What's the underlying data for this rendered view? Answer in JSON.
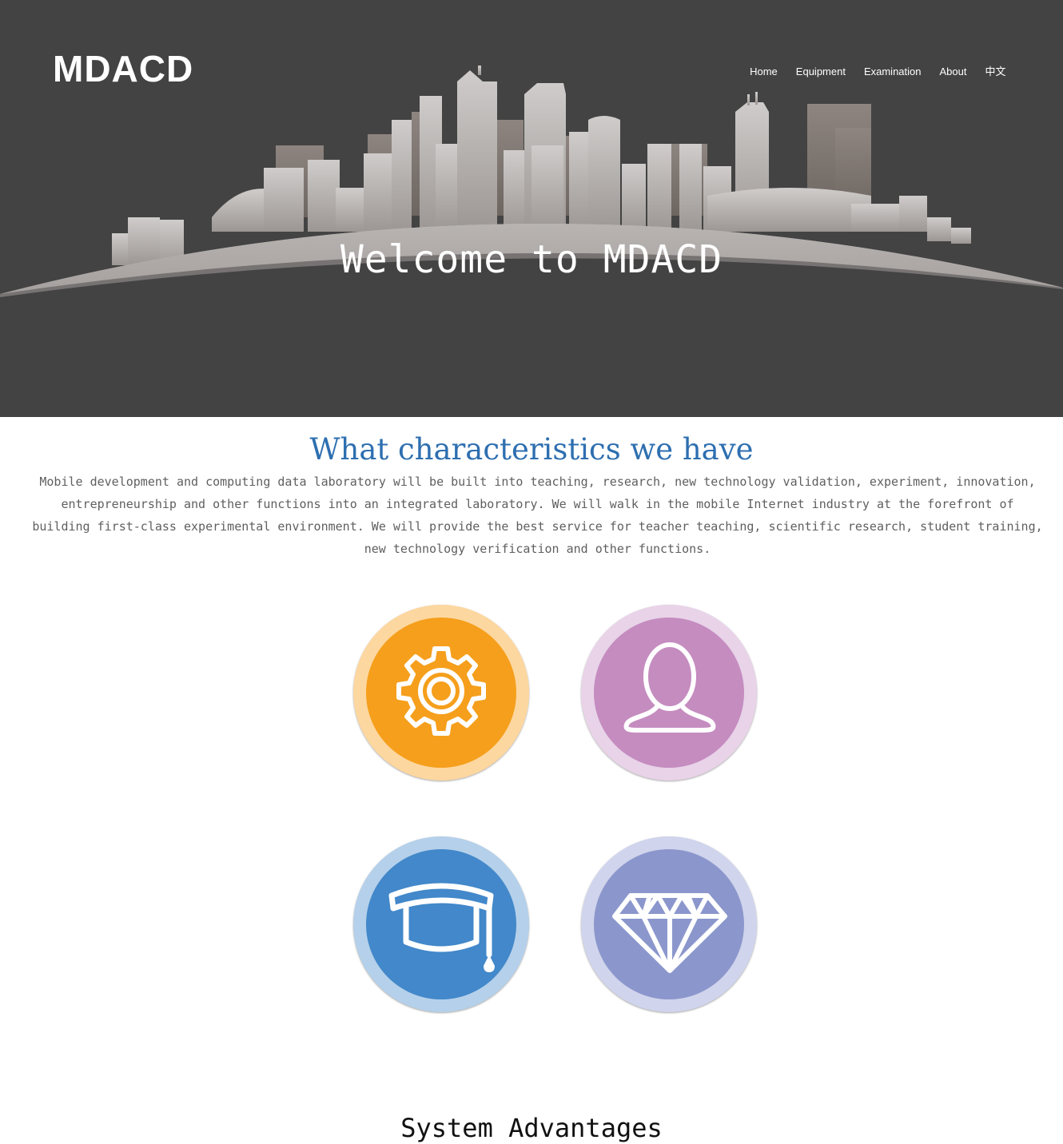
{
  "header": {
    "logo": "MDACD",
    "nav": [
      {
        "label": "Home"
      },
      {
        "label": "Equipment"
      },
      {
        "label": "Examination"
      },
      {
        "label": "About"
      },
      {
        "label": "中文"
      }
    ]
  },
  "hero": {
    "title": "Welcome to MDACD"
  },
  "characteristics": {
    "title": "What characteristics we have",
    "description": "Mobile development and computing data laboratory will be built into teaching, research, new technology validation, experiment, innovation, entrepreneurship and other functions into an integrated laboratory. We will walk in the mobile Internet industry at the forefront of building first-class experimental environment. We will provide the best service for teacher teaching, scientific research, student training, new technology verification and other functions.",
    "features": [
      {
        "icon": "gear-icon",
        "ring_color": "#fdd7a0",
        "core_color": "#f59f1c"
      },
      {
        "icon": "user-icon",
        "ring_color": "#e8d3e8",
        "core_color": "#c58cc0"
      },
      {
        "icon": "graduation-cap-icon",
        "ring_color": "#b5d0ea",
        "core_color": "#4288ca"
      },
      {
        "icon": "diamond-icon",
        "ring_color": "#d0d4ec",
        "core_color": "#8b97cc"
      }
    ]
  },
  "advantages": {
    "title": "System Advantages"
  }
}
